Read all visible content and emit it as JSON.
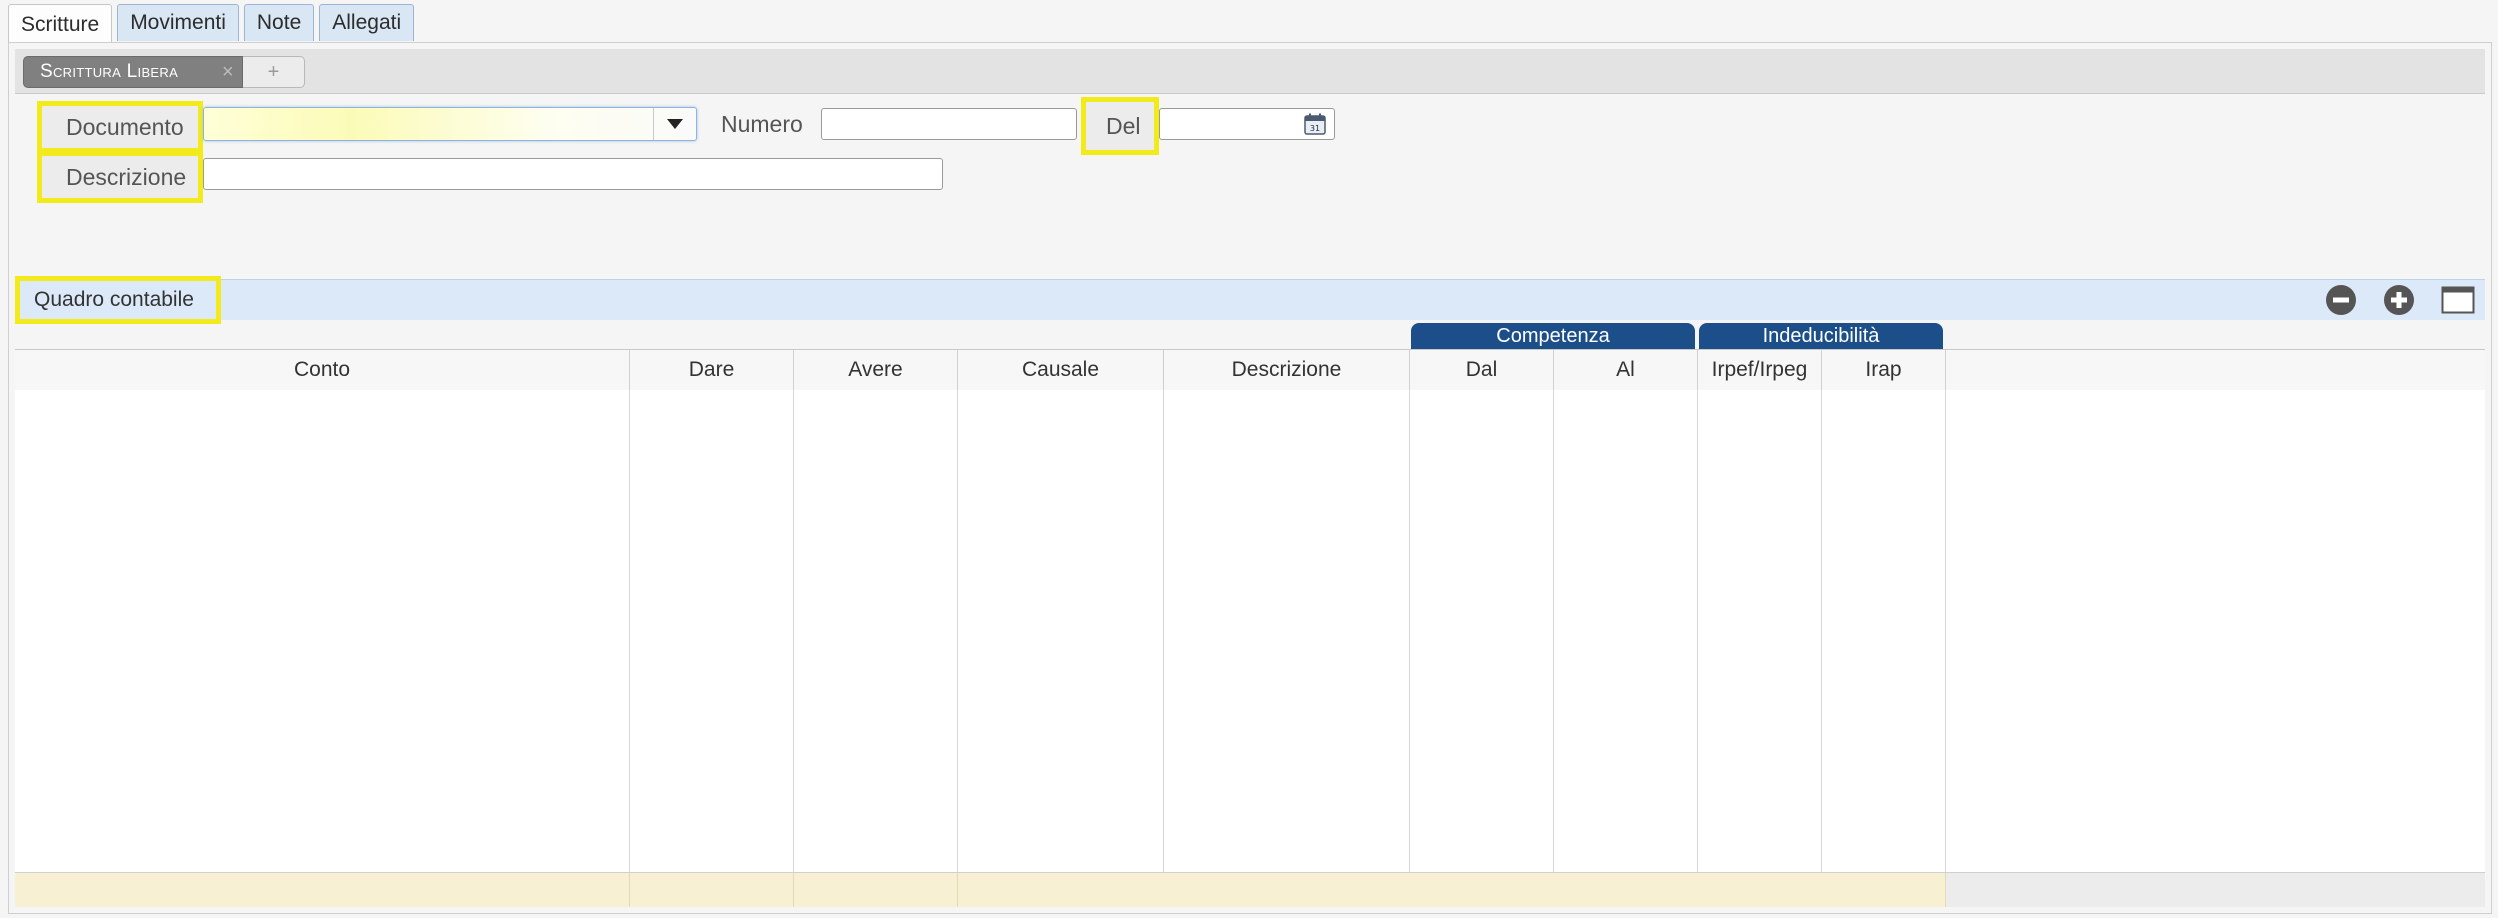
{
  "tabs": [
    "Scritture",
    "Movimenti",
    "Note",
    "Allegati"
  ],
  "subtab": {
    "label": "Scrittura Libera",
    "close": "×",
    "add": "+"
  },
  "form": {
    "documento_label": "Documento",
    "documento_value": "",
    "numero_label": "Numero",
    "numero_value": "",
    "del_label": "Del",
    "del_value": "",
    "descrizione_label": "Descrizione",
    "descrizione_value": ""
  },
  "panel": {
    "title": "Quadro contabile"
  },
  "grid": {
    "groups": [
      "Competenza",
      "Indeducibilità"
    ],
    "columns": [
      "Conto",
      "Dare",
      "Avere",
      "Causale",
      "Descrizione",
      "Dal",
      "Al",
      "Irpef/Irpeg",
      "Irap"
    ]
  },
  "icons": {
    "calendar": "calendar-icon",
    "remove": "minus-circle-icon",
    "add": "plus-circle-icon",
    "maximize": "window-maximize-icon"
  },
  "colors": {
    "highlight": "#f3ea1c",
    "group_header": "#1c4f8a",
    "panel_header": "#dbe9f8",
    "footer": "#f7f0d2"
  }
}
